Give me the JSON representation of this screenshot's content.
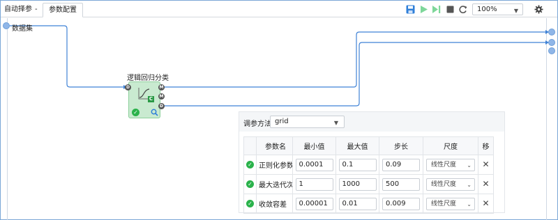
{
  "tabs": {
    "first_label": "自动择参",
    "separator": "-",
    "active_label": "参数配置"
  },
  "toolbar": {
    "icons": [
      "save-icon",
      "play-icon",
      "step-run-icon",
      "stop-icon",
      "refresh-icon",
      "settings-icon"
    ],
    "zoom_value": "100%",
    "accent_color": "#2f7fd8",
    "disabled_color": "#7ed79a"
  },
  "canvas": {
    "dataset_label": "数据集",
    "node_title": "逻辑回归分类",
    "ports": {
      "input": "D",
      "outputs": [
        "M",
        "M",
        "D"
      ]
    },
    "node_status_icons": [
      "check-circle-icon",
      "magnifier-icon"
    ],
    "node_model_badge": "C",
    "link_color": "#3f82d6"
  },
  "panel": {
    "method_label": "调参方法",
    "method_value": "grid",
    "columns": [
      "参数名",
      "最小值",
      "最大值",
      "步长",
      "尺度",
      "移"
    ],
    "rows": [
      {
        "name": "正则化参数",
        "min": "0.0001",
        "max": "0.1",
        "step": "0.09",
        "scale": "线性尺度"
      },
      {
        "name": "最大迭代次数",
        "min": "1",
        "max": "1000",
        "step": "500",
        "scale": "线性尺度"
      },
      {
        "name": "收敛容差",
        "min": "0.00001",
        "max": "0.01",
        "step": "0.009",
        "scale": "线性尺度"
      }
    ]
  }
}
